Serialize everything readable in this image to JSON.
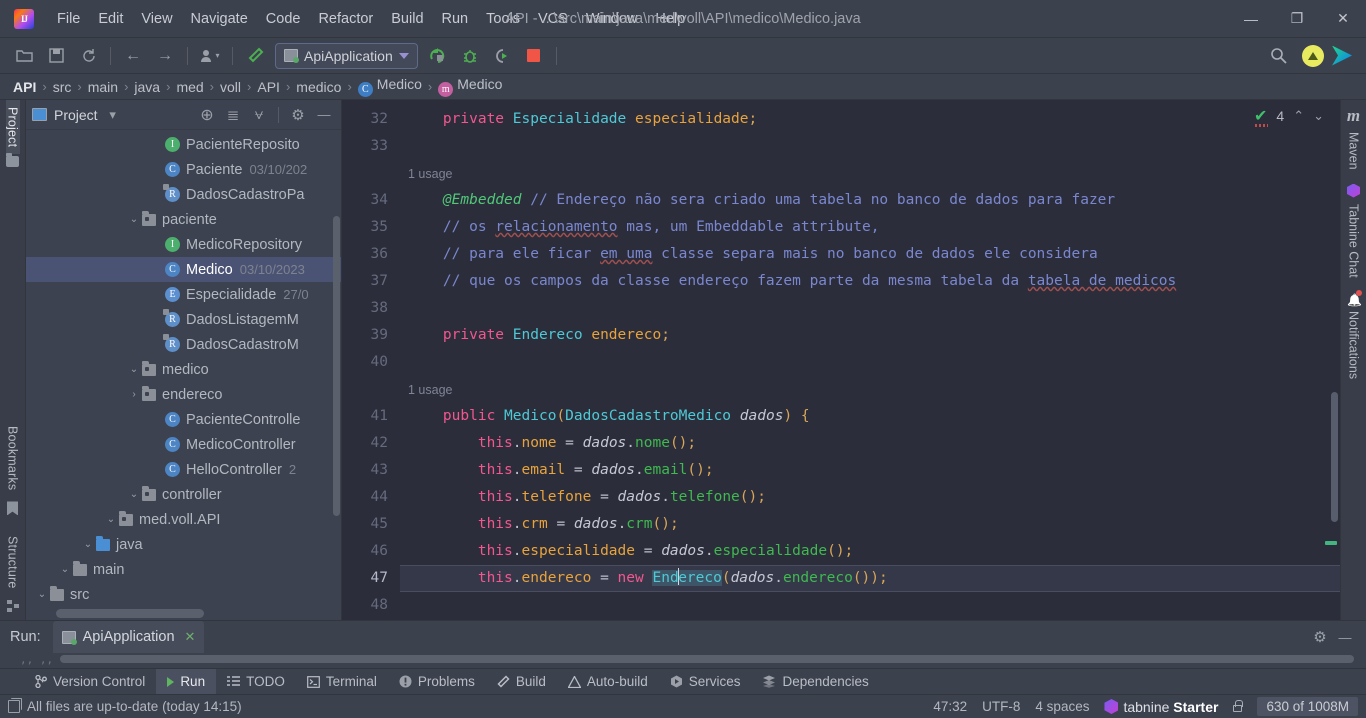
{
  "titlebar": {
    "logo_text": "IJ",
    "menus": [
      "File",
      "Edit",
      "View",
      "Navigate",
      "Code",
      "Refactor",
      "Build",
      "Run",
      "Tools",
      "VCS",
      "Window",
      "Help"
    ],
    "window_title": "API - ...\\src\\main\\java\\med\\voll\\API\\medico\\Medico.java",
    "minimize": "—",
    "maximize": "❐",
    "close": "✕"
  },
  "toolbar": {
    "open_icon": "folder-open",
    "save_icon": "save",
    "sync_icon": "sync",
    "back_icon": "←",
    "forward_icon": "→",
    "profile_icon": "user",
    "hammer_icon": "build",
    "run_config_name": "ApiApplication",
    "run_icon": "run",
    "debug_icon": "debug",
    "run_coverage_icon": "run-coverage",
    "stop_icon": "stop",
    "search_icon": "search",
    "update_icon": "update",
    "ide_icon": "ide-logo"
  },
  "breadcrumb": {
    "items": [
      {
        "label": "API",
        "icon": ""
      },
      {
        "label": "src",
        "icon": ""
      },
      {
        "label": "main",
        "icon": ""
      },
      {
        "label": "java",
        "icon": ""
      },
      {
        "label": "med",
        "icon": ""
      },
      {
        "label": "voll",
        "icon": ""
      },
      {
        "label": "API",
        "icon": ""
      },
      {
        "label": "medico",
        "icon": ""
      },
      {
        "label": "Medico",
        "icon": "C"
      },
      {
        "label": "Medico",
        "icon": "m"
      }
    ],
    "separator": "›"
  },
  "left_strip": {
    "project_tab": "Project",
    "bookmarks_tab": "Bookmarks",
    "structure_tab": "Structure"
  },
  "right_strip": {
    "maven_tab": "Maven",
    "maven_glyph": "m",
    "tabnine_tab": "Tabnine Chat",
    "notifications_tab": "Notifications"
  },
  "project_panel": {
    "title": "Project",
    "caret": "▾",
    "locate_icon": "⊕",
    "expand_icon": "≣",
    "collapse_icon": "⩝",
    "settings_icon": "⚙",
    "hide_icon": "—",
    "tree": [
      {
        "indent": 1,
        "twisty": "⌄",
        "icon": "folder",
        "label": "src",
        "date": ""
      },
      {
        "indent": 2,
        "twisty": "⌄",
        "icon": "folder",
        "label": "main",
        "date": ""
      },
      {
        "indent": 3,
        "twisty": "⌄",
        "icon": "folder-blue",
        "label": "java",
        "date": ""
      },
      {
        "indent": 4,
        "twisty": "⌄",
        "icon": "package",
        "label": "med.voll.API",
        "date": ""
      },
      {
        "indent": 5,
        "twisty": "⌄",
        "icon": "package",
        "label": "controller",
        "date": ""
      },
      {
        "indent": 6,
        "twisty": "",
        "icon": "class-c",
        "label": "HelloController",
        "date": "2"
      },
      {
        "indent": 6,
        "twisty": "",
        "icon": "class-c",
        "label": "MedicoController",
        "date": ""
      },
      {
        "indent": 6,
        "twisty": "",
        "icon": "class-c",
        "label": "PacienteControlle",
        "date": ""
      },
      {
        "indent": 5,
        "twisty": "›",
        "icon": "package",
        "label": "endereco",
        "date": ""
      },
      {
        "indent": 5,
        "twisty": "⌄",
        "icon": "package",
        "label": "medico",
        "date": ""
      },
      {
        "indent": 6,
        "twisty": "",
        "icon": "record-r",
        "label": "DadosCadastroM",
        "date": ""
      },
      {
        "indent": 6,
        "twisty": "",
        "icon": "record-r",
        "label": "DadosListagemM",
        "date": ""
      },
      {
        "indent": 6,
        "twisty": "",
        "icon": "enum-e",
        "label": "Especialidade",
        "date": "27/0"
      },
      {
        "indent": 6,
        "twisty": "",
        "icon": "class-c",
        "label": "Medico",
        "date": "03/10/2023",
        "selected": true
      },
      {
        "indent": 6,
        "twisty": "",
        "icon": "interface-i",
        "label": "MedicoRepository",
        "date": ""
      },
      {
        "indent": 5,
        "twisty": "⌄",
        "icon": "package",
        "label": "paciente",
        "date": ""
      },
      {
        "indent": 6,
        "twisty": "",
        "icon": "record-r",
        "label": "DadosCadastroPa",
        "date": ""
      },
      {
        "indent": 6,
        "twisty": "",
        "icon": "class-c",
        "label": "Paciente",
        "date": "03/10/202"
      },
      {
        "indent": 6,
        "twisty": "",
        "icon": "interface-i",
        "label": "PacienteReposito",
        "date": ""
      }
    ]
  },
  "editor": {
    "inspection_count": "4",
    "inspection_up": "⌃",
    "inspection_down": "⌄",
    "usage_hint": "1 usage",
    "lines": [
      {
        "num": "32",
        "kind": "code"
      },
      {
        "num": "33",
        "kind": "blank"
      },
      {
        "num": "",
        "kind": "usage"
      },
      {
        "num": "34",
        "kind": "code"
      },
      {
        "num": "35",
        "kind": "code"
      },
      {
        "num": "36",
        "kind": "code"
      },
      {
        "num": "37",
        "kind": "code"
      },
      {
        "num": "38",
        "kind": "blank"
      },
      {
        "num": "39",
        "kind": "code"
      },
      {
        "num": "40",
        "kind": "blank"
      },
      {
        "num": "",
        "kind": "usage"
      },
      {
        "num": "41",
        "kind": "code"
      },
      {
        "num": "42",
        "kind": "code"
      },
      {
        "num": "43",
        "kind": "code"
      },
      {
        "num": "44",
        "kind": "code"
      },
      {
        "num": "45",
        "kind": "code"
      },
      {
        "num": "46",
        "kind": "code"
      },
      {
        "num": "47",
        "kind": "code",
        "current": true
      },
      {
        "num": "48",
        "kind": "blank"
      }
    ],
    "source_text": [
      "    private Especialidade especialidade;",
      "",
      "    @Embedded // Endereço não sera criado uma tabela no banco de dados para fazer",
      "    // os relacionamento mas, um Embeddable attribute,",
      "    // para ele ficar em uma classe separa mais no banco de dados ele considera",
      "    // que os campos da classe endereço fazem parte da mesma tabela da tabela de medicos",
      "",
      "    private Endereco endereco;",
      "",
      "    public Medico(DadosCadastroMedico dados) {",
      "        this.nome = dados.nome();",
      "        this.email = dados.email();",
      "        this.telefone = dados.telefone();",
      "        this.crm = dados.crm();",
      "        this.especialidade = dados.especialidade();",
      "        this.endereco = new Endereco(dados.endereco());",
      ""
    ]
  },
  "run_panel": {
    "run_label": "Run:",
    "tab_name": "ApiApplication",
    "tab_close": "✕",
    "settings_icon": "⚙",
    "hide_icon": "—"
  },
  "bottom_bar": {
    "items": [
      {
        "label": "Version Control",
        "icon": "branch-icon",
        "active": false
      },
      {
        "label": "Run",
        "icon": "run-icon",
        "active": true
      },
      {
        "label": "TODO",
        "icon": "todo-icon",
        "active": false
      },
      {
        "label": "Terminal",
        "icon": "terminal-icon",
        "active": false
      },
      {
        "label": "Problems",
        "icon": "problems-icon",
        "active": false
      },
      {
        "label": "Build",
        "icon": "build-icon",
        "active": false
      },
      {
        "label": "Auto-build",
        "icon": "auto-build-icon",
        "active": false
      },
      {
        "label": "Services",
        "icon": "services-icon",
        "active": false
      },
      {
        "label": "Dependencies",
        "icon": "dependencies-icon",
        "active": false
      }
    ]
  },
  "status_bar": {
    "message": "All files are up-to-date (today 14:15)",
    "caret_position": "47:32",
    "encoding": "UTF-8",
    "indent": "4 spaces",
    "tabnine_name": "tabnine ",
    "tabnine_plan": "Starter",
    "memory": "630 of 1008M"
  },
  "colors": {
    "accent_green": "#3fc16a",
    "selection_blue": "#4b5375",
    "editor_bg": "#2b2d3a",
    "panel_bg": "#3c424f",
    "chrome_bg": "#3c414e"
  }
}
